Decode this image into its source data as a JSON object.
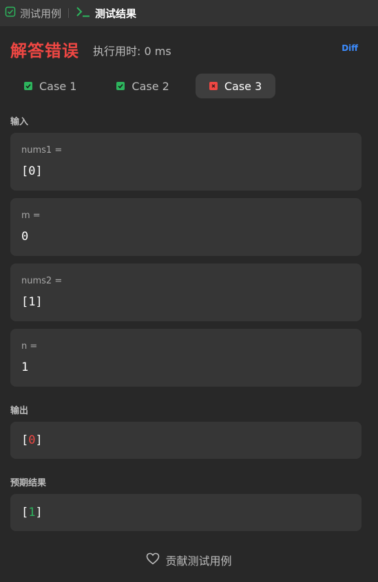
{
  "topbar": {
    "tab_testcases": "测试用例",
    "tab_results": "测试结果"
  },
  "result": {
    "verdict": "解答错误",
    "runtime": "执行用时: 0 ms",
    "diff_label": "Diff"
  },
  "cases": [
    {
      "label": "Case 1",
      "status": "pass"
    },
    {
      "label": "Case 2",
      "status": "pass"
    },
    {
      "label": "Case 3",
      "status": "fail",
      "active": true
    }
  ],
  "input": {
    "label": "输入",
    "vars": [
      {
        "name": "nums1 =",
        "value": "[0]"
      },
      {
        "name": "m =",
        "value": "0"
      },
      {
        "name": "nums2 =",
        "value": "[1]"
      },
      {
        "name": "n =",
        "value": "1"
      }
    ]
  },
  "output": {
    "label": "输出",
    "open": "[",
    "value": "0",
    "close": "]"
  },
  "expected": {
    "label": "预期结果",
    "open": "[",
    "value": "1",
    "close": "]"
  },
  "contribute_label": "贡献测试用例",
  "colors": {
    "error": "#ef4743",
    "success": "#2db55d",
    "link": "#3c8cff"
  }
}
